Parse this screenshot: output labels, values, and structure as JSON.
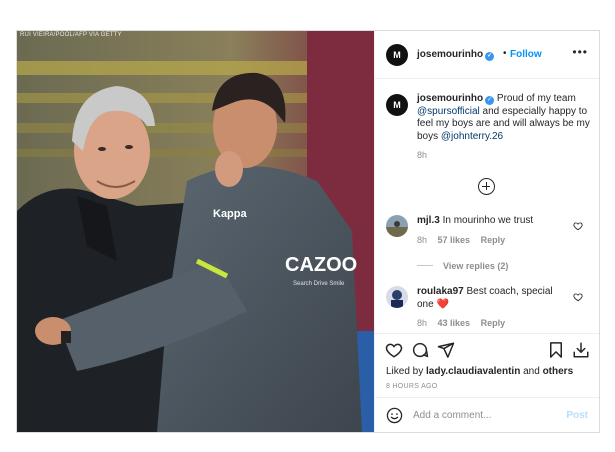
{
  "photo": {
    "credit": "RUI VIEIRA/POOL/AFP VIA GETTY",
    "jacket_brand": "Kappa",
    "jacket_sponsor": "CAZOO",
    "jacket_tagline": "Search Drive Smile"
  },
  "post": {
    "author": "josemourinho",
    "avatar_initial": "M",
    "follow_label": "Follow",
    "separator": "•",
    "more_label": "•••",
    "caption_parts": {
      "text1": "Proud of my team ",
      "mention1": "@spursofficial",
      "text2": " and especially happy to feel my boys are and will always be my boys ",
      "mention2": "@johnterry.26"
    },
    "caption_time": "8h"
  },
  "comments": [
    {
      "user": "mjl.3",
      "text": "In mourinho we trust",
      "time": "8h",
      "likes": "57 likes",
      "reply_label": "Reply",
      "view_replies": "View replies (2)"
    },
    {
      "user": "roulaka97",
      "text": "Best coach, special one ❤️",
      "time": "8h",
      "likes": "43 likes",
      "reply_label": "Reply"
    }
  ],
  "actions": {
    "liked_by_prefix": "Liked by ",
    "liked_by_user": "lady.claudiavalentin",
    "liked_by_and": " and ",
    "liked_by_others": "others",
    "posted_ago": "8 HOURS AGO",
    "comment_placeholder": "Add a comment...",
    "post_label": "Post"
  },
  "colors": {
    "accent": "#0095f6",
    "verified": "#3897f0",
    "mention": "#00376b",
    "muted": "#8e8e8e"
  },
  "icons": [
    "more-icon",
    "verified-icon",
    "plus-circle-icon",
    "heart-icon",
    "comment-icon",
    "share-icon",
    "bookmark-icon",
    "save-icon",
    "emoji-icon"
  ]
}
